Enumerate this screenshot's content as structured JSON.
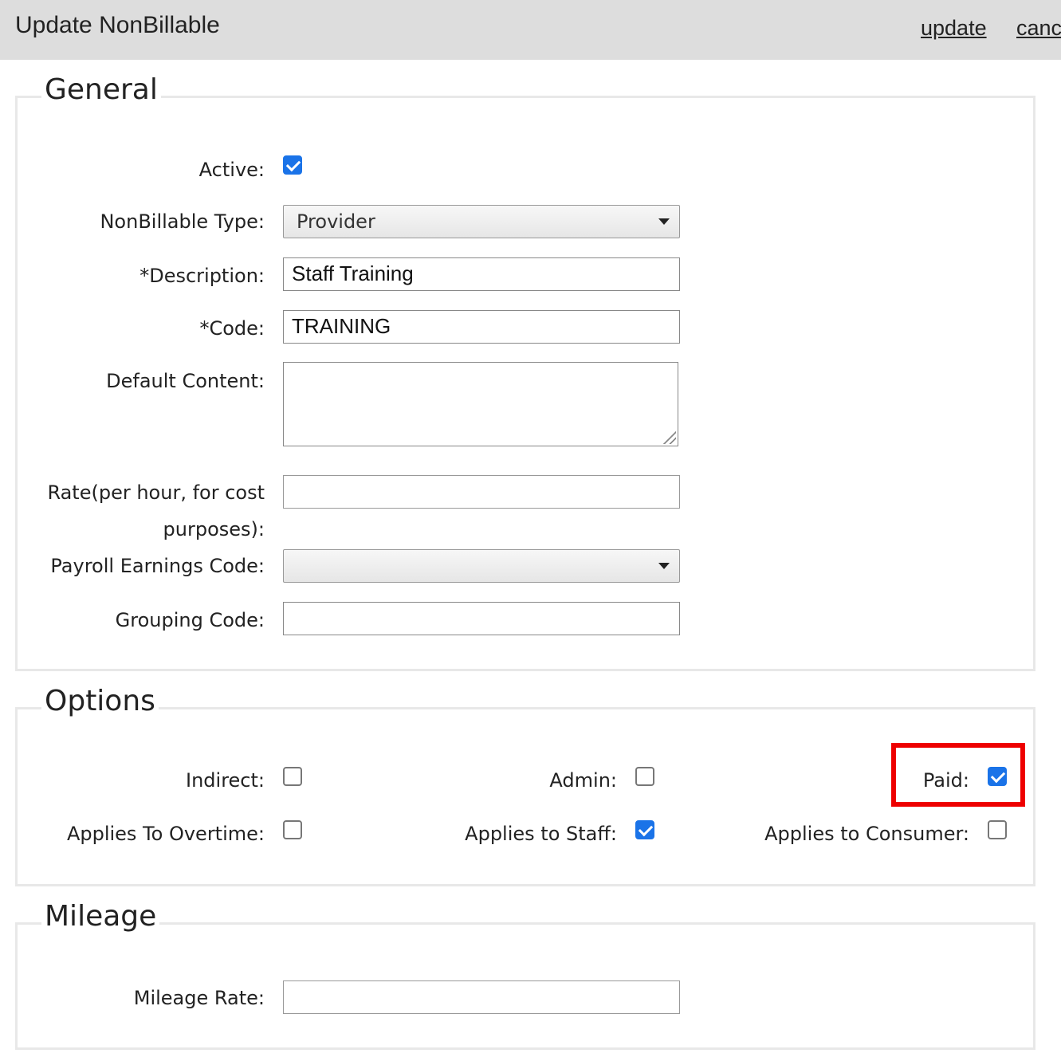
{
  "header": {
    "title": "Update NonBillable",
    "update_label": "update",
    "cancel_label": "cancel"
  },
  "general": {
    "legend": "General",
    "active": {
      "label": "Active:",
      "checked": true
    },
    "type": {
      "label": "NonBillable Type:",
      "value": "Provider"
    },
    "description": {
      "label": "*Description:",
      "value": "Staff Training"
    },
    "code": {
      "label": "*Code:",
      "value": "TRAINING"
    },
    "default_content": {
      "label": "Default Content:",
      "value": ""
    },
    "rate": {
      "label_line1": "Rate(per hour, for cost",
      "label_line2": "purposes):",
      "value": ""
    },
    "payroll": {
      "label": "Payroll Earnings Code:",
      "value": ""
    },
    "grouping": {
      "label": "Grouping Code:",
      "value": ""
    }
  },
  "options": {
    "legend": "Options",
    "indirect": {
      "label": "Indirect:",
      "checked": false
    },
    "admin": {
      "label": "Admin:",
      "checked": false
    },
    "paid": {
      "label": "Paid:",
      "checked": true
    },
    "overtime": {
      "label": "Applies To Overtime:",
      "checked": false
    },
    "staff": {
      "label": "Applies to Staff:",
      "checked": true
    },
    "consumer": {
      "label": "Applies to Consumer:",
      "checked": false
    }
  },
  "mileage": {
    "legend": "Mileage",
    "rate": {
      "label": "Mileage Rate:",
      "value": ""
    }
  },
  "colors": {
    "header_bg": "#dddddd",
    "checkbox_checked": "#1a73e8",
    "highlight": "#ee0000"
  }
}
